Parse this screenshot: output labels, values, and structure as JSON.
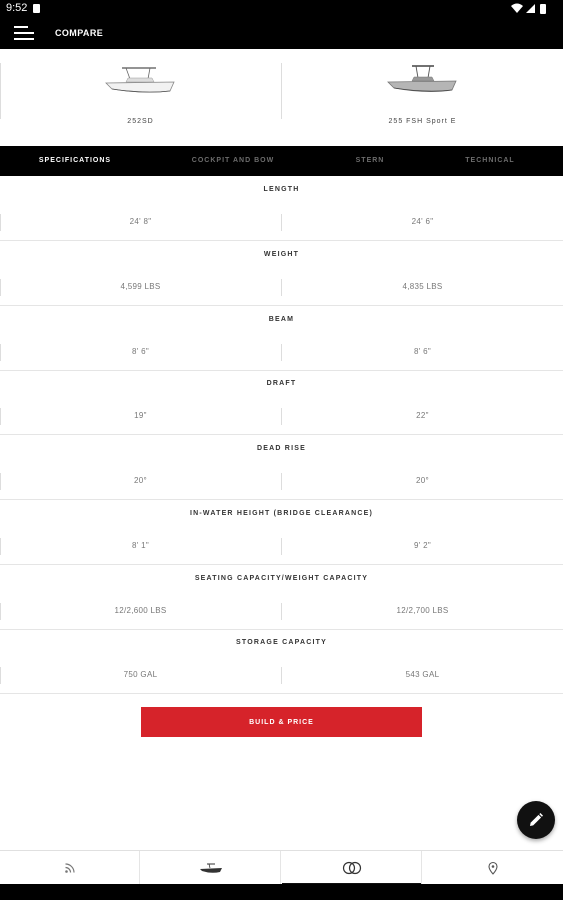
{
  "status_bar": {
    "time": "9:52"
  },
  "app_bar": {
    "title": "COMPARE",
    "menu_icon": "hamburger-menu-icon"
  },
  "boats": [
    {
      "name": "252SD",
      "hull_color": "#f2f2f2"
    },
    {
      "name": "255 FSH Sport E",
      "hull_color": "#b5b5b5"
    }
  ],
  "tabs": [
    {
      "label": "SPECIFICATIONS",
      "active": true
    },
    {
      "label": "COCKPIT AND BOW",
      "active": false
    },
    {
      "label": "STERN",
      "active": false
    },
    {
      "label": "TECHNICAL",
      "active": false
    }
  ],
  "specs": [
    {
      "label": "LENGTH",
      "left": "24' 8\"",
      "right": "24' 6\""
    },
    {
      "label": "WEIGHT",
      "left": "4,599 LBS",
      "right": "4,835 LBS"
    },
    {
      "label": "BEAM",
      "left": "8' 6\"",
      "right": "8' 6\""
    },
    {
      "label": "DRAFT",
      "left": "19\"",
      "right": "22\""
    },
    {
      "label": "DEAD RISE",
      "left": "20°",
      "right": "20°"
    },
    {
      "label": "IN-WATER HEIGHT (BRIDGE CLEARANCE)",
      "left": "8' 1\"",
      "right": "9' 2\""
    },
    {
      "label": "SEATING CAPACITY/WEIGHT CAPACITY",
      "left": "12/2,600 LBS",
      "right": "12/2,700 LBS"
    },
    {
      "label": "STORAGE CAPACITY",
      "left": "750 GAL",
      "right": "543 GAL"
    }
  ],
  "cta": {
    "label": "BUILD & PRICE"
  },
  "fab": {
    "icon": "edit-pencil-icon"
  },
  "bottom_nav": [
    {
      "icon": "rss-feed-icon",
      "active": false
    },
    {
      "icon": "boat-icon",
      "active": false
    },
    {
      "icon": "compare-circles-icon",
      "active": true
    },
    {
      "icon": "location-pin-icon",
      "active": false
    }
  ],
  "colors": {
    "accent": "#d6232a",
    "bar": "#000000"
  }
}
